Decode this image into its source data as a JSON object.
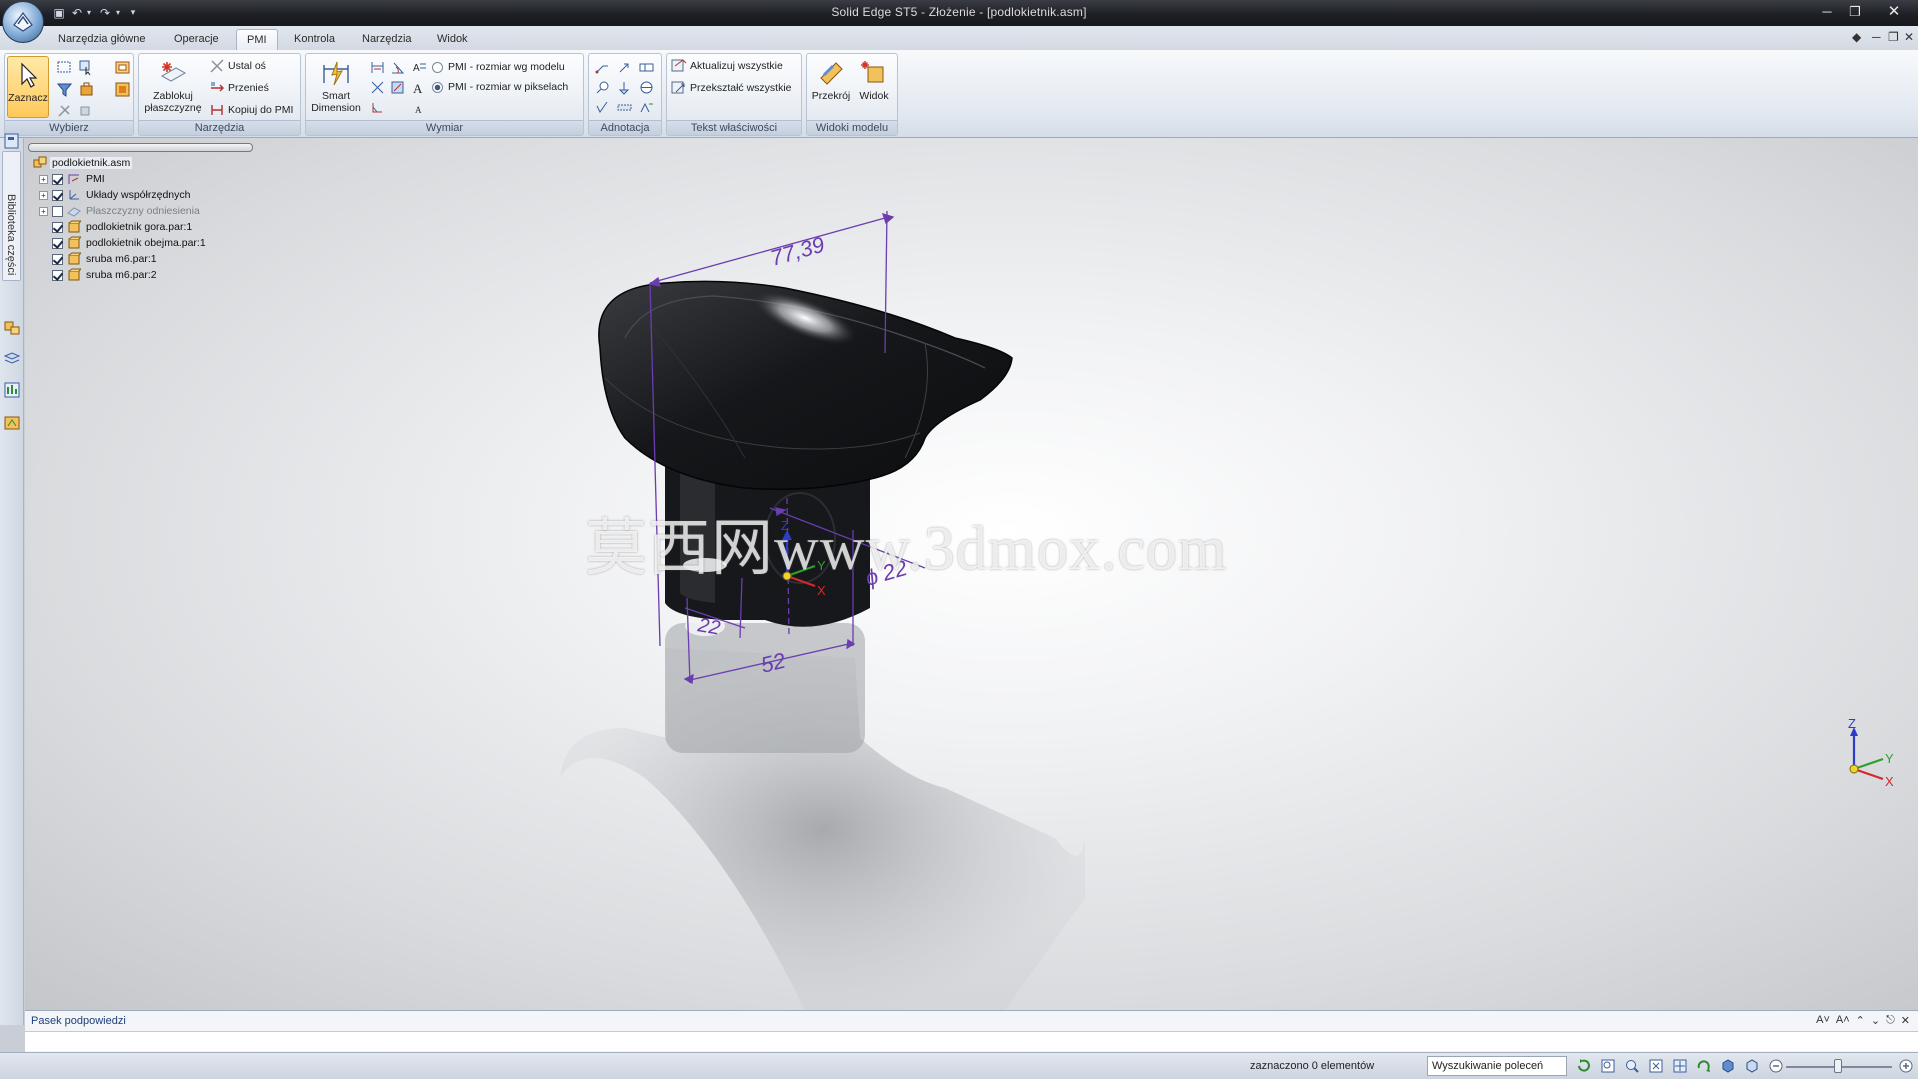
{
  "window": {
    "title": "Solid Edge ST5 - Złożenie - [podlokietnik.asm]"
  },
  "ribbon_tabs": [
    {
      "label": "Narzędzia główne",
      "active": false
    },
    {
      "label": "Operacje",
      "active": false
    },
    {
      "label": "PMI",
      "active": true
    },
    {
      "label": "Kontrola",
      "active": false
    },
    {
      "label": "Narzędzia",
      "active": false
    },
    {
      "label": "Widok",
      "active": false
    }
  ],
  "ribbon": {
    "wybierz": {
      "label": "Wybierz",
      "zaznacz_label": "Zaznacz"
    },
    "narzedzia": {
      "label": "Narzędzia",
      "zablokuj_label": "Zablokuj płaszczyznę",
      "ustal_os": "Ustal oś",
      "przenies": "Przenieś",
      "kopiuj_do_pmi": "Kopiuj do PMI"
    },
    "wymiar": {
      "label": "Wymiar",
      "smart_dimension": "Smart Dimension",
      "pmi_wg_modelu": "PMI - rozmiar wg modelu",
      "pmi_w_pikselach": "PMI - rozmiar w pikselach",
      "selected_option": "PMI - rozmiar w pikselach"
    },
    "adnotacja": {
      "label": "Adnotacja"
    },
    "tekst_wlasciwosci": {
      "label": "Tekst właściwości",
      "aktualizuj": "Aktualizuj wszystkie",
      "przeksztalc": "Przekształć wszystkie"
    },
    "widoki_modelu": {
      "label": "Widoki modelu",
      "przekroj": "Przekrój",
      "widok": "Widok"
    }
  },
  "side_panel": {
    "tab_label": "Biblioteka części"
  },
  "tree": [
    {
      "label": "podlokietnik.asm",
      "level": 0,
      "expander": false,
      "checkbox": false,
      "checked": false,
      "icon": "assembly-icon"
    },
    {
      "label": "PMI",
      "level": 1,
      "expander": true,
      "checkbox": true,
      "checked": true,
      "icon": "pmi-icon"
    },
    {
      "label": "Układy współrzędnych",
      "level": 1,
      "expander": true,
      "checkbox": true,
      "checked": true,
      "icon": "coordinate-system-icon"
    },
    {
      "label": "Płaszczyzny odniesienia",
      "level": 1,
      "expander": true,
      "checkbox": true,
      "checked": false,
      "icon": "reference-plane-icon"
    },
    {
      "label": "podlokietnik gora.par:1",
      "level": 1,
      "expander": false,
      "checkbox": true,
      "checked": true,
      "icon": "part-icon"
    },
    {
      "label": "podlokietnik obejma.par:1",
      "level": 1,
      "expander": false,
      "checkbox": true,
      "checked": true,
      "icon": "part-icon"
    },
    {
      "label": "sruba m6.par:1",
      "level": 1,
      "expander": false,
      "checkbox": true,
      "checked": true,
      "icon": "part-icon"
    },
    {
      "label": "sruba m6.par:2",
      "level": 1,
      "expander": false,
      "checkbox": true,
      "checked": true,
      "icon": "part-icon"
    }
  ],
  "model": {
    "dimensions": {
      "top_width": "77,39",
      "diameter": "22",
      "inner_width": "22",
      "bottom_width": "52"
    },
    "triad_labels": {
      "z": "Z",
      "y": "Y",
      "x": "X"
    },
    "watermark": "莫西网www.3dmox.com",
    "colors": {
      "dimension": "#6a3db0",
      "part": "#1c1d20"
    }
  },
  "prompt_bar": {
    "title": "Pasek podpowiedzi"
  },
  "status_bar": {
    "selection_text": "zaznaczono 0 elementów",
    "command_search": "Wyszukiwanie poleceń"
  }
}
